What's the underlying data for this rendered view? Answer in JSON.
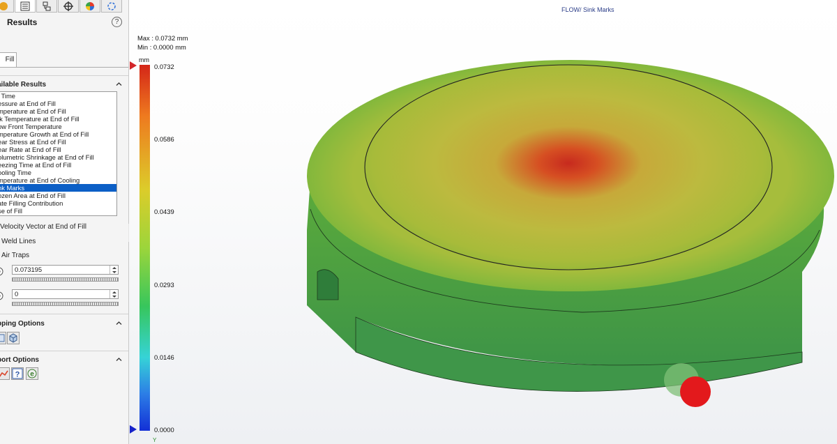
{
  "panel": {
    "title": "Results",
    "toolbar_icons": [
      "results-icon",
      "property-list-icon",
      "configuration-icon",
      "crosshair-icon",
      "appearance-icon",
      "display-icon"
    ],
    "tab": "Fill",
    "available_results_header": "ailable Results",
    "results": [
      "l Time",
      "essure at End of Fill",
      "mperature at End of Fill",
      "lk Temperature at End of Fill",
      "ow Front Temperature",
      "mperature Growth at End of Fill",
      "ear Stress at End of Fill",
      "ear Rate at End of Fill",
      "olumetric Shrinkage at End of Fill",
      "eezing Time at End of Fill",
      "ooling Time",
      "mperature at End of Cooling",
      "nk Marks",
      "ozen Area at End of Fill",
      "ate Filling Contribution",
      "se of Fill"
    ],
    "selected_index": 12,
    "velocity_vector": "Velocity Vector at End of Fill",
    "weld_lines": "Weld Lines",
    "air_traps": "Air Traps",
    "max_value": "0.073195",
    "min_value": "0",
    "clipping_header": "pping Options",
    "report_header": "port Options"
  },
  "viewport": {
    "title": "FLOW/ Sink Marks",
    "max_label": "Max : 0.0732 mm",
    "min_label": "Min : 0.0000 mm",
    "unit": "mm",
    "ticks": [
      "0.0732",
      "0.0586",
      "0.0439",
      "0.0293",
      "0.0146",
      "0.0000"
    ],
    "axis_label": "Y",
    "colors": {
      "max": "#d42618",
      "mid": "#9cd53b",
      "min": "#1330d6",
      "selection": "#0c5fc6"
    }
  }
}
